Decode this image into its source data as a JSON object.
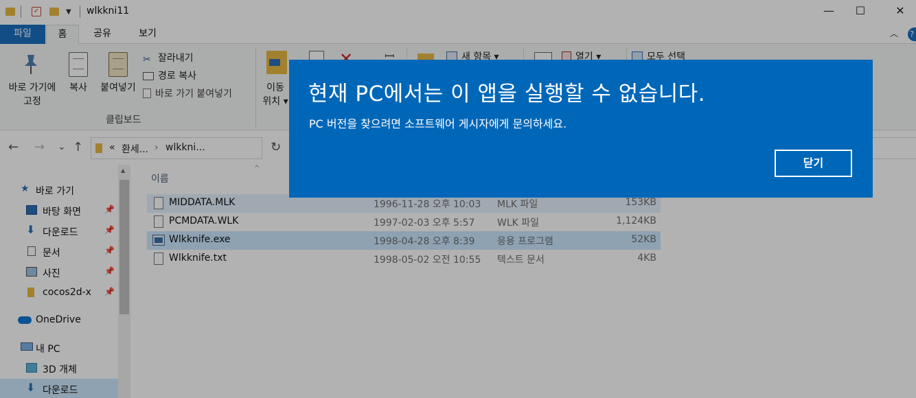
{
  "window": {
    "title": "wlkkni11",
    "buttons": {
      "minimize": "—",
      "maximize": "☐",
      "close": "✕"
    }
  },
  "ribbon": {
    "tabs": [
      "파일",
      "홈",
      "공유",
      "보기"
    ],
    "collapse_glyph": "︿",
    "help_glyph": "?",
    "clipboard": {
      "pin": [
        "바로 가기에",
        "고정"
      ],
      "copy": "복사",
      "paste": "붙여넣기",
      "cut": "잘라내기",
      "copy_path": "경로 복사",
      "paste_shortcut": "바로 가기 붙여넣기",
      "group_label": "클립보드"
    },
    "organize": {
      "move_to": [
        "이동",
        "위치 ▾"
      ]
    },
    "new": {
      "new_item": "새 항목 ▾"
    },
    "open": {
      "open": "열기 ▾"
    },
    "select": {
      "select_all": "모두 선택"
    }
  },
  "address": {
    "back": "←",
    "forward": "→",
    "recent": "⌄",
    "up": "↑",
    "chevron": "«",
    "crumb_1": "환세...",
    "sep": "›",
    "crumb_2": "wlkkni...",
    "refresh": "↻"
  },
  "nav": {
    "items": [
      {
        "label": "바로 가기",
        "pinned": false
      },
      {
        "label": "바탕 화면",
        "pinned": true
      },
      {
        "label": "다운로드",
        "pinned": true
      },
      {
        "label": "문서",
        "pinned": true
      },
      {
        "label": "사진",
        "pinned": true
      },
      {
        "label": "cocos2d-x",
        "pinned": true
      },
      {
        "label": "OneDrive",
        "pinned": false
      },
      {
        "label": "내 PC",
        "pinned": false
      },
      {
        "label": "3D 개체",
        "pinned": false
      },
      {
        "label": "다운로드",
        "pinned": false
      }
    ],
    "pin_glyph": "📌"
  },
  "files": {
    "column_name": "이름",
    "sort_glyph": "^",
    "rows": [
      {
        "name": "MIDDATA.MLK",
        "date": "1996-11-28 오후 10:03",
        "type": "MLK 파일",
        "size": "153KB"
      },
      {
        "name": "PCMDATA.WLK",
        "date": "1997-02-03 오후 5:57",
        "type": "WLK 파일",
        "size": "1,124KB"
      },
      {
        "name": "Wlkknife.exe",
        "date": "1998-04-28 오후 8:39",
        "type": "응용 프로그램",
        "size": "52KB"
      },
      {
        "name": "Wlkknife.txt",
        "date": "1998-05-02 오전 10:55",
        "type": "텍스트 문서",
        "size": "4KB"
      }
    ]
  },
  "dialog": {
    "title": "현재 PC에서는 이 앱을 실행할 수 없습니다.",
    "message": "PC 버전을 찾으려면 소프트웨어 게시자에게 문의하세요.",
    "close_button": "닫기",
    "background": "#0067b8"
  }
}
